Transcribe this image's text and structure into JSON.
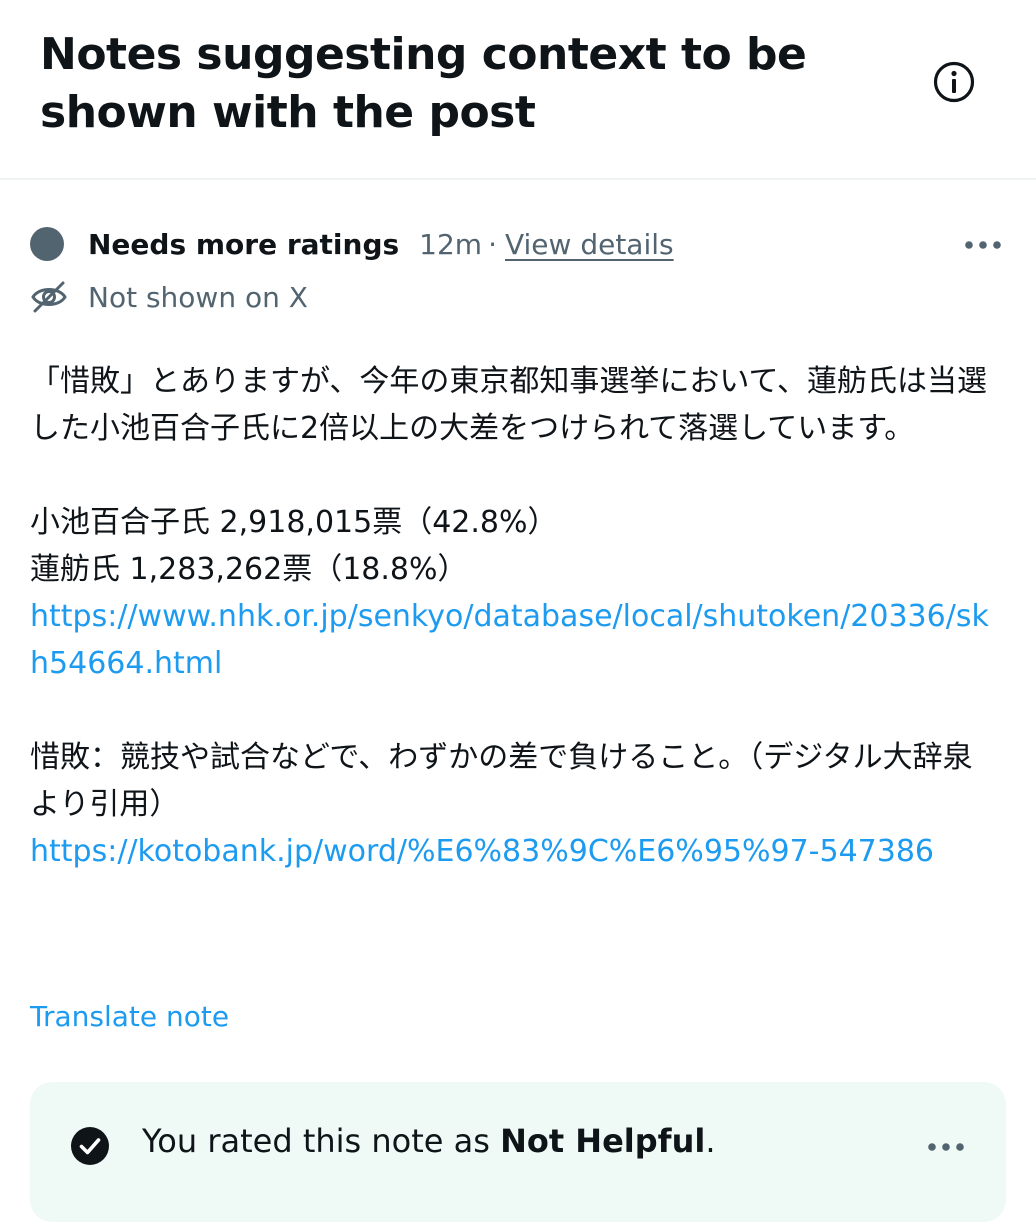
{
  "header": {
    "title": "Notes suggesting context to be shown with the post",
    "info_icon": "info-icon"
  },
  "note": {
    "status": "Needs more ratings",
    "time": "12m",
    "separator": "·",
    "view_details": "View details",
    "visibility": "Not shown on X",
    "paragraph1": "「惜敗」とありますが、今年の東京都知事選挙において、蓮舫氏は当選した小池百合子氏に2倍以上の大差をつけられて落選しています。",
    "result_line1": "小池百合子氏 2,918,015票（42.8%）",
    "result_line2": "蓮舫氏 1,283,262票（18.8%）",
    "link1": "https://www.nhk.or.jp/senkyo/database/local/shutoken/20336/skh54664.html",
    "definition": "惜敗：競技や試合などで、わずかの差で負けること。（デジタル大辞泉より引用）",
    "link2": "https://kotobank.jp/word/%E6%83%9C%E6%95%97-547386",
    "translate": "Translate note"
  },
  "rating": {
    "prefix": "You rated this note as ",
    "value": "Not Helpful",
    "suffix": "."
  },
  "colors": {
    "text": "#0f1419",
    "secondary": "#536471",
    "link": "#1d9bf0",
    "rating_bg": "#effaf6",
    "divider": "#eff3f4"
  }
}
